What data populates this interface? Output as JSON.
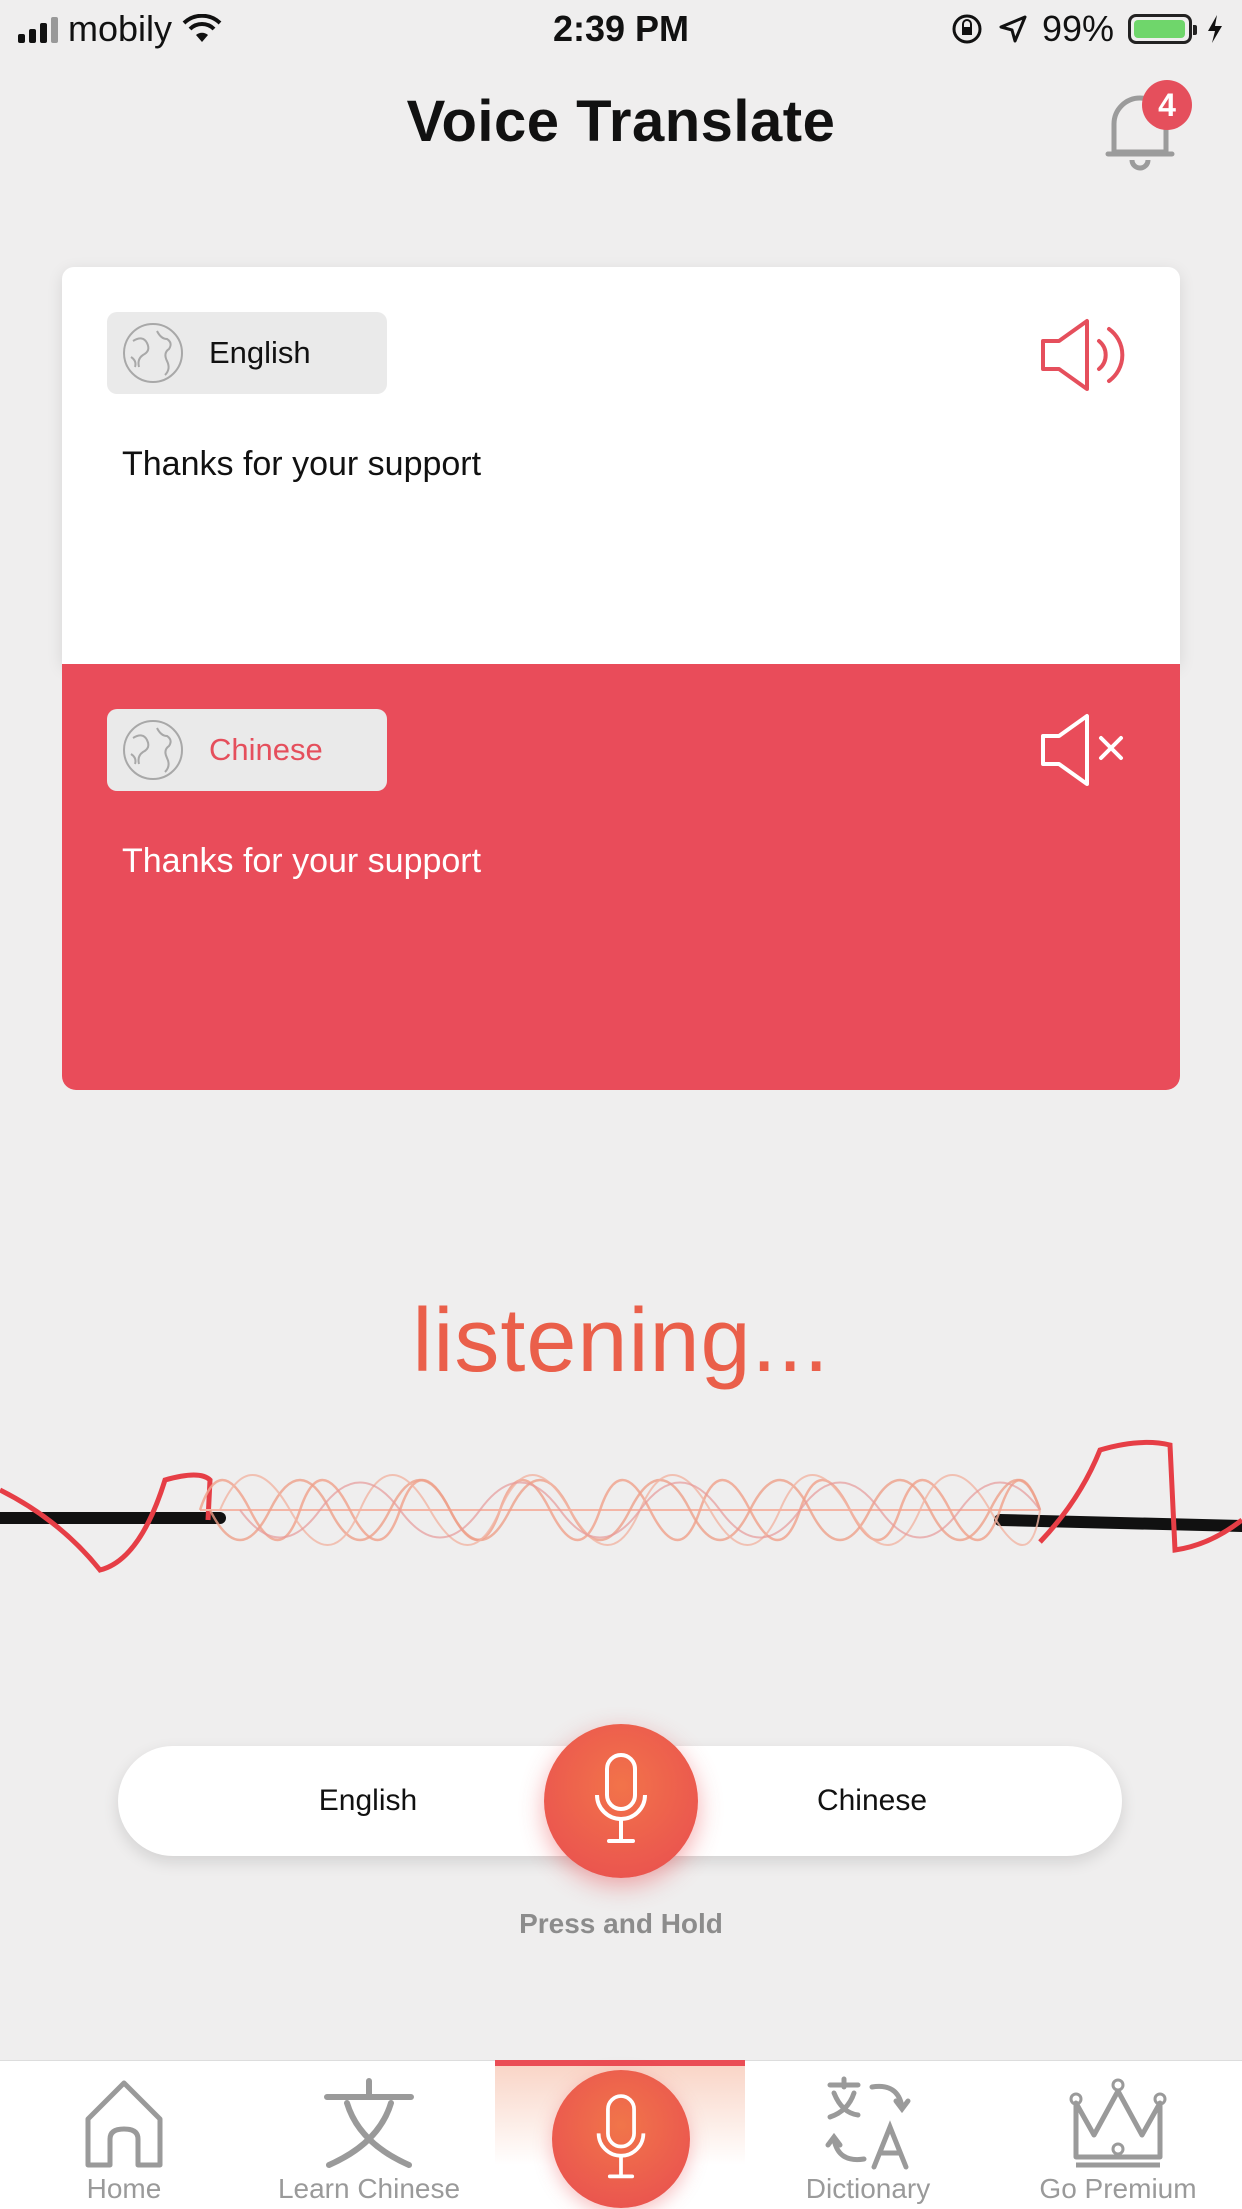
{
  "status_bar": {
    "carrier": "mobily",
    "time": "2:39 PM",
    "battery": "99%",
    "battery_level": 0.99
  },
  "header": {
    "title": "Voice Translate",
    "notification_count": "4"
  },
  "source_card": {
    "language": "English",
    "text": "Thanks for your support"
  },
  "target_card": {
    "language": "Chinese",
    "text": "Thanks for your support"
  },
  "listening": {
    "label": "listening..."
  },
  "language_toggle": {
    "left": "English",
    "right": "Chinese",
    "hint": "Press and Hold"
  },
  "tabs": [
    {
      "label": "Home",
      "icon": "home-icon"
    },
    {
      "label": "Learn Chinese",
      "icon": "chinese-character-icon"
    },
    {
      "label": "",
      "icon": "microphone-icon",
      "active": true
    },
    {
      "label": "Dictionary",
      "icon": "translate-icon"
    },
    {
      "label": "Go Premium",
      "icon": "crown-icon"
    }
  ],
  "colors": {
    "accent": "#e94c5a",
    "listening": "#ea5f4a",
    "background": "#efeeee"
  }
}
